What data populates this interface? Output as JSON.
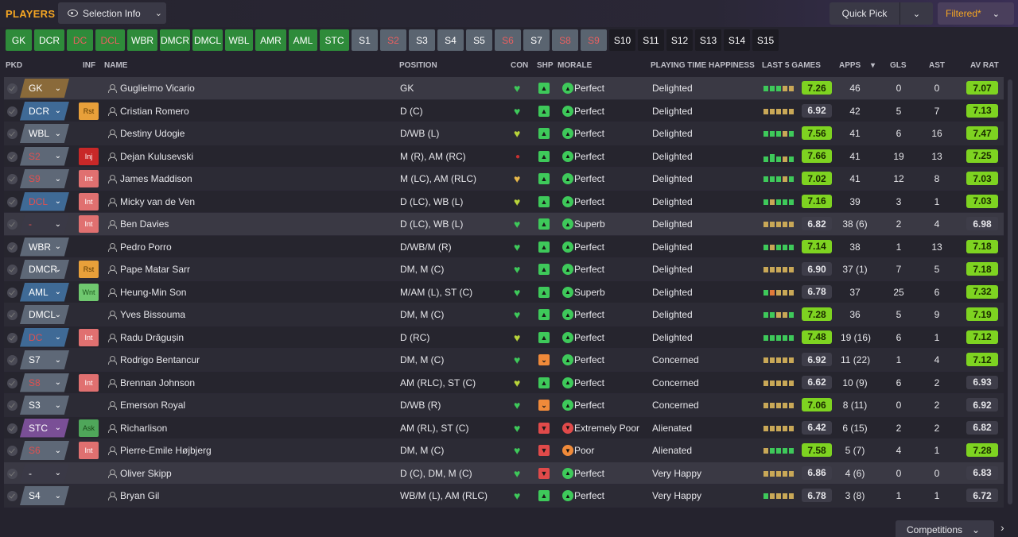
{
  "header": {
    "title": "PLAYERS",
    "selection_info": "Selection Info",
    "quick_pick": "Quick Pick",
    "filtered": "Filtered*"
  },
  "position_buttons": [
    {
      "label": "GK",
      "style": "green"
    },
    {
      "label": "DCR",
      "style": "green"
    },
    {
      "label": "DC",
      "style": "green-red"
    },
    {
      "label": "DCL",
      "style": "green-red"
    },
    {
      "label": "WBR",
      "style": "green"
    },
    {
      "label": "DMCR",
      "style": "green"
    },
    {
      "label": "DMCL",
      "style": "green"
    },
    {
      "label": "WBL",
      "style": "green"
    },
    {
      "label": "AMR",
      "style": "green"
    },
    {
      "label": "AML",
      "style": "green"
    },
    {
      "label": "STC",
      "style": "green"
    },
    {
      "label": "S1",
      "style": "grey"
    },
    {
      "label": "S2",
      "style": "grey-red"
    },
    {
      "label": "S3",
      "style": "grey"
    },
    {
      "label": "S4",
      "style": "grey"
    },
    {
      "label": "S5",
      "style": "grey"
    },
    {
      "label": "S6",
      "style": "grey-red"
    },
    {
      "label": "S7",
      "style": "grey"
    },
    {
      "label": "S8",
      "style": "grey-red"
    },
    {
      "label": "S9",
      "style": "grey-red"
    },
    {
      "label": "S10",
      "style": "black"
    },
    {
      "label": "S11",
      "style": "black"
    },
    {
      "label": "S12",
      "style": "black"
    },
    {
      "label": "S13",
      "style": "black"
    },
    {
      "label": "S14",
      "style": "black"
    },
    {
      "label": "S15",
      "style": "black"
    }
  ],
  "columns": {
    "pkd": "PKD",
    "inf": "INF",
    "name": "NAME",
    "position": "POSITION",
    "con": "CON",
    "shp": "SHP",
    "morale": "MORALE",
    "pth": "PLAYING TIME HAPPINESS",
    "last5": "LAST 5 GAMES",
    "apps": "APPS",
    "gls": "GLS",
    "ast": "AST",
    "avrat": "AV RAT"
  },
  "players": [
    {
      "pkd": "GK",
      "chip": "gk",
      "chip_red": false,
      "inf": "",
      "name": "Guglielmo Vicario",
      "position": "GK",
      "heart": "#3ec95a",
      "shp": "green",
      "morale": "Perfect",
      "morale_c": "green",
      "pth": "Delighted",
      "form": "gggbb",
      "last5": "7.26",
      "l5c": "green",
      "apps": "46",
      "gls": "0",
      "ast": "0",
      "avrat": "7.07",
      "arc": "green"
    },
    {
      "pkd": "DCR",
      "chip": "def",
      "chip_red": false,
      "inf": "Rst",
      "name": "Cristian Romero",
      "position": "D (C)",
      "heart": "#3ec95a",
      "shp": "green",
      "morale": "Perfect",
      "morale_c": "green",
      "pth": "Delighted",
      "form": "bbbbb",
      "last5": "6.92",
      "l5c": "grey",
      "apps": "42",
      "gls": "5",
      "ast": "7",
      "avrat": "7.13",
      "arc": "green"
    },
    {
      "pkd": "WBL",
      "chip": "mid",
      "chip_red": false,
      "inf": "",
      "name": "Destiny Udogie",
      "position": "D/WB (L)",
      "heart": "#b8d43a",
      "shp": "green",
      "morale": "Perfect",
      "morale_c": "green",
      "pth": "Delighted",
      "form": "gggbg",
      "last5": "7.56",
      "l5c": "green",
      "apps": "41",
      "gls": "6",
      "ast": "16",
      "avrat": "7.47",
      "arc": "green"
    },
    {
      "pkd": "S2",
      "chip": "mid",
      "chip_red": true,
      "inf": "Inj",
      "name": "Dejan Kulusevski",
      "position": "M (R), AM (RC)",
      "heart": "#c83030",
      "shp": "green",
      "morale": "Perfect",
      "morale_c": "green",
      "pth": "Delighted",
      "form": "gtgbg",
      "last5": "7.66",
      "l5c": "green",
      "apps": "41",
      "gls": "19",
      "ast": "13",
      "avrat": "7.25",
      "arc": "green"
    },
    {
      "pkd": "S9",
      "chip": "mid",
      "chip_red": true,
      "inf": "Int",
      "name": "James Maddison",
      "position": "M (LC), AM (RLC)",
      "heart": "#e8b84a",
      "shp": "green",
      "morale": "Perfect",
      "morale_c": "green",
      "pth": "Delighted",
      "form": "gggbg",
      "last5": "7.02",
      "l5c": "green",
      "apps": "41",
      "gls": "12",
      "ast": "8",
      "avrat": "7.03",
      "arc": "green"
    },
    {
      "pkd": "DCL",
      "chip": "def",
      "chip_red": true,
      "inf": "Int",
      "name": "Micky van de Ven",
      "position": "D (LC), WB (L)",
      "heart": "#b8d43a",
      "shp": "green",
      "morale": "Perfect",
      "morale_c": "green",
      "pth": "Delighted",
      "form": "gbggg",
      "last5": "7.16",
      "l5c": "green",
      "apps": "39",
      "gls": "3",
      "ast": "1",
      "avrat": "7.03",
      "arc": "green"
    },
    {
      "pkd": "-",
      "chip": "none",
      "chip_red": true,
      "inf": "Int",
      "name": "Ben Davies",
      "position": "D (LC), WB (L)",
      "heart": "#3ec95a",
      "shp": "green",
      "morale": "Superb",
      "morale_c": "green",
      "pth": "Delighted",
      "form": "bbbbb",
      "last5": "6.82",
      "l5c": "grey",
      "apps": "38 (6)",
      "gls": "2",
      "ast": "4",
      "avrat": "6.98",
      "arc": "grey"
    },
    {
      "pkd": "WBR",
      "chip": "mid",
      "chip_red": false,
      "inf": "",
      "name": "Pedro Porro",
      "position": "D/WB/M (R)",
      "heart": "#3ec95a",
      "shp": "green",
      "morale": "Perfect",
      "morale_c": "green",
      "pth": "Delighted",
      "form": "gbggg",
      "last5": "7.14",
      "l5c": "green",
      "apps": "38",
      "gls": "1",
      "ast": "13",
      "avrat": "7.18",
      "arc": "green"
    },
    {
      "pkd": "DMCR",
      "chip": "mid",
      "chip_red": false,
      "inf": "Rst",
      "name": "Pape Matar Sarr",
      "position": "DM, M (C)",
      "heart": "#3ec95a",
      "shp": "green",
      "morale": "Perfect",
      "morale_c": "green",
      "pth": "Delighted",
      "form": "bbbbb",
      "last5": "6.90",
      "l5c": "grey",
      "apps": "37 (1)",
      "gls": "7",
      "ast": "5",
      "avrat": "7.18",
      "arc": "green"
    },
    {
      "pkd": "AML",
      "chip": "def",
      "chip_red": false,
      "inf": "Wnt",
      "name": "Heung-Min Son",
      "position": "M/AM (L), ST (C)",
      "heart": "#3ec95a",
      "shp": "green",
      "morale": "Superb",
      "morale_c": "green",
      "pth": "Delighted",
      "form": "gobbb",
      "last5": "6.78",
      "l5c": "grey",
      "apps": "37",
      "gls": "25",
      "ast": "6",
      "avrat": "7.32",
      "arc": "green"
    },
    {
      "pkd": "DMCL",
      "chip": "mid",
      "chip_red": false,
      "inf": "",
      "name": "Yves Bissouma",
      "position": "DM, M (C)",
      "heart": "#3ec95a",
      "shp": "green",
      "morale": "Perfect",
      "morale_c": "green",
      "pth": "Delighted",
      "form": "ggbbg",
      "last5": "7.28",
      "l5c": "green",
      "apps": "36",
      "gls": "5",
      "ast": "9",
      "avrat": "7.19",
      "arc": "green"
    },
    {
      "pkd": "DC",
      "chip": "def",
      "chip_red": true,
      "inf": "Int",
      "name": "Radu Drăgușin",
      "position": "D (RC)",
      "heart": "#b8d43a",
      "shp": "green",
      "morale": "Perfect",
      "morale_c": "green",
      "pth": "Delighted",
      "form": "ggggg",
      "last5": "7.48",
      "l5c": "green",
      "apps": "19 (16)",
      "gls": "6",
      "ast": "1",
      "avrat": "7.12",
      "arc": "green"
    },
    {
      "pkd": "S7",
      "chip": "mid",
      "chip_red": false,
      "inf": "",
      "name": "Rodrigo Bentancur",
      "position": "DM, M (C)",
      "heart": "#3ec95a",
      "shp": "orange",
      "morale": "Perfect",
      "morale_c": "green",
      "pth": "Concerned",
      "form": "bbbbb",
      "last5": "6.92",
      "l5c": "grey",
      "apps": "11 (22)",
      "gls": "1",
      "ast": "4",
      "avrat": "7.12",
      "arc": "green"
    },
    {
      "pkd": "S8",
      "chip": "mid",
      "chip_red": true,
      "inf": "Int",
      "name": "Brennan Johnson",
      "position": "AM (RLC), ST (C)",
      "heart": "#b8d43a",
      "shp": "green",
      "morale": "Perfect",
      "morale_c": "green",
      "pth": "Concerned",
      "form": "bbbbb",
      "last5": "6.62",
      "l5c": "grey",
      "apps": "10 (9)",
      "gls": "6",
      "ast": "2",
      "avrat": "6.93",
      "arc": "grey"
    },
    {
      "pkd": "S3",
      "chip": "mid",
      "chip_red": false,
      "inf": "",
      "name": "Emerson Royal",
      "position": "D/WB (R)",
      "heart": "#3ec95a",
      "shp": "orange",
      "morale": "Perfect",
      "morale_c": "green",
      "pth": "Concerned",
      "form": "bbbbb",
      "last5": "7.06",
      "l5c": "green",
      "apps": "8 (11)",
      "gls": "0",
      "ast": "2",
      "avrat": "6.92",
      "arc": "grey"
    },
    {
      "pkd": "STC",
      "chip": "att",
      "chip_red": false,
      "inf": "Ask",
      "name": "Richarlison",
      "position": "AM (RL), ST (C)",
      "heart": "#3ec95a",
      "shp": "red",
      "morale": "Extremely Poor",
      "morale_c": "red",
      "pth": "Alienated",
      "form": "bbbbb",
      "last5": "6.42",
      "l5c": "grey",
      "apps": "6 (15)",
      "gls": "2",
      "ast": "2",
      "avrat": "6.82",
      "arc": "grey"
    },
    {
      "pkd": "S6",
      "chip": "mid",
      "chip_red": true,
      "inf": "Int",
      "name": "Pierre-Emile Højbjerg",
      "position": "DM, M (C)",
      "heart": "#3ec95a",
      "shp": "red",
      "morale": "Poor",
      "morale_c": "orange",
      "pth": "Alienated",
      "form": "bgggg",
      "last5": "7.58",
      "l5c": "green",
      "apps": "5 (7)",
      "gls": "4",
      "ast": "1",
      "avrat": "7.28",
      "arc": "green"
    },
    {
      "pkd": "-",
      "chip": "none",
      "chip_red": false,
      "inf": "",
      "name": "Oliver Skipp",
      "position": "D (C), DM, M (C)",
      "heart": "#3ec95a",
      "shp": "red",
      "morale": "Perfect",
      "morale_c": "green",
      "pth": "Very Happy",
      "form": "bbbbb",
      "last5": "6.86",
      "l5c": "grey",
      "apps": "4 (6)",
      "gls": "0",
      "ast": "0",
      "avrat": "6.83",
      "arc": "grey"
    },
    {
      "pkd": "S4",
      "chip": "mid",
      "chip_red": false,
      "inf": "",
      "name": "Bryan Gil",
      "position": "WB/M (L), AM (RLC)",
      "heart": "#3ec95a",
      "shp": "green",
      "morale": "Perfect",
      "morale_c": "green",
      "pth": "Very Happy",
      "form": "gbbbb",
      "last5": "6.78",
      "l5c": "grey",
      "apps": "3 (8)",
      "gls": "1",
      "ast": "1",
      "avrat": "6.72",
      "arc": "grey"
    }
  ],
  "footer": {
    "competitions": "Competitions"
  }
}
